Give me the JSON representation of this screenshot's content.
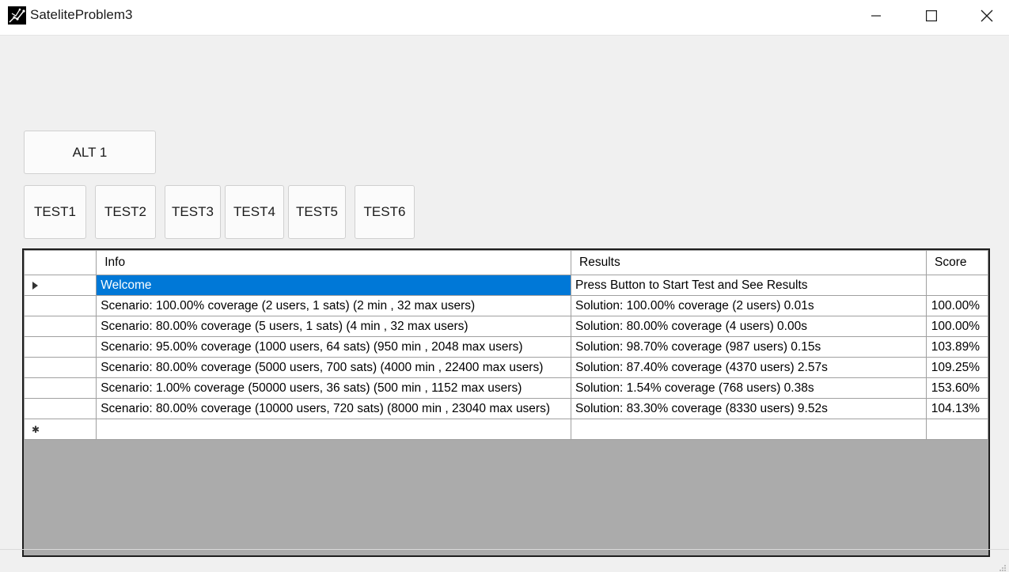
{
  "window": {
    "title": "SateliteProblem3"
  },
  "buttons": {
    "alt": "ALT 1",
    "tests": [
      "TEST1",
      "TEST2",
      "TEST3",
      "TEST4",
      "TEST5",
      "TEST6"
    ]
  },
  "grid": {
    "columns": [
      "Info",
      "Results",
      "Score"
    ],
    "rows": [
      {
        "info": "Welcome",
        "results": "Press Button to Start Test and See Results",
        "score": ""
      },
      {
        "info": "Scenario: 100.00% coverage (2 users, 1 sats)   (2 min , 32 max users)",
        "results": "Solution: 100.00% coverage (2 users) 0.01s",
        "score": "100.00%"
      },
      {
        "info": "Scenario: 80.00% coverage (5 users, 1 sats)   (4 min , 32 max users)",
        "results": "Solution: 80.00% coverage (4 users) 0.00s",
        "score": "100.00%"
      },
      {
        "info": "Scenario: 95.00% coverage (1000 users, 64 sats)   (950 min , 2048 max users)",
        "results": "Solution: 98.70% coverage (987 users) 0.15s",
        "score": "103.89%"
      },
      {
        "info": "Scenario: 80.00% coverage (5000 users, 700 sats)   (4000 min , 22400 max users)",
        "results": "Solution: 87.40% coverage (4370 users) 2.57s",
        "score": "109.25%"
      },
      {
        "info": "Scenario: 1.00% coverage (50000 users, 36 sats)   (500 min , 1152 max users)",
        "results": "Solution: 1.54% coverage (768 users) 0.38s",
        "score": "153.60%"
      },
      {
        "info": "Scenario: 80.00% coverage (10000 users, 720 sats)   (8000 min , 23040 max users)",
        "results": "Solution: 83.30% coverage (8330 users) 9.52s",
        "score": "104.13%"
      }
    ],
    "selection_color": "#0078d7"
  },
  "icons": {
    "app": "satellite-app-icon",
    "minimize": "minimize-icon",
    "maximize": "maximize-icon",
    "close": "close-icon",
    "current_row": "current-row-arrow-icon",
    "new_row": "new-row-asterisk-icon",
    "grip": "resize-grip-icon"
  }
}
